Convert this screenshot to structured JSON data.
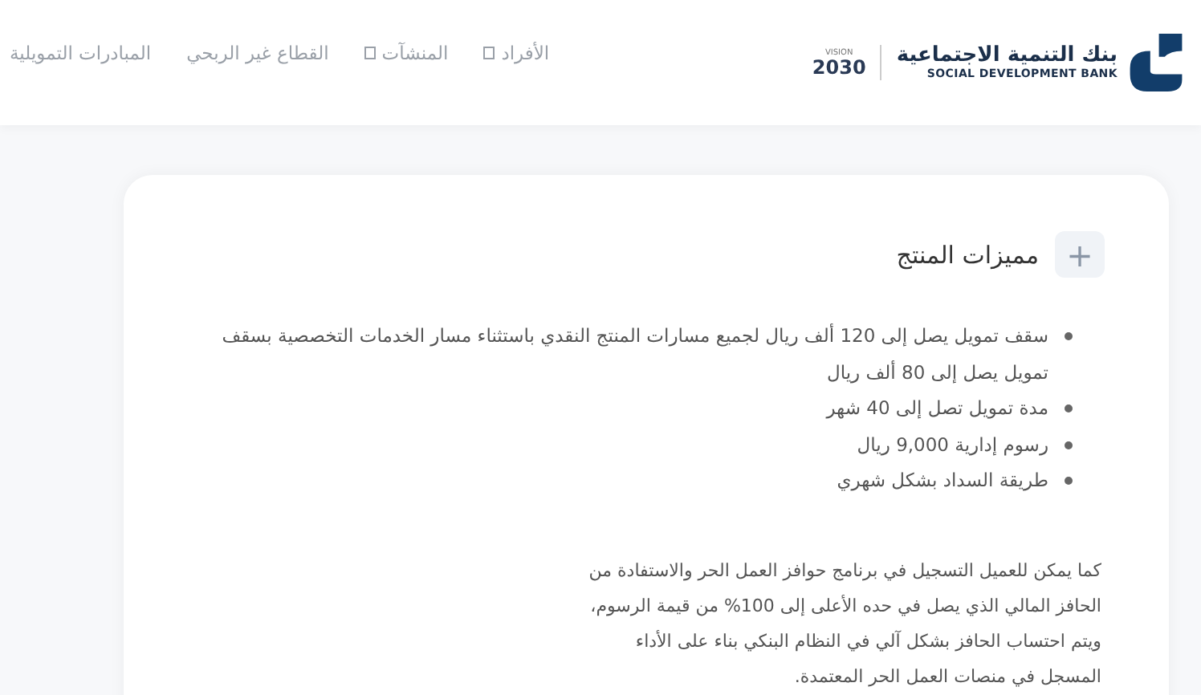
{
  "header": {
    "logo": {
      "name_ar": "بنك التنمية الاجتماعية",
      "name_en": "SOCIAL DEVELOPMENT BANK",
      "vision_label": "VISION",
      "vision_year": "2030"
    },
    "nav": [
      {
        "label": "الأفراد",
        "has_dropdown": true
      },
      {
        "label": "المنشآت",
        "has_dropdown": true
      },
      {
        "label": "القطاع غير الربحي",
        "has_dropdown": false
      },
      {
        "label": "المبادرات التمويلية",
        "has_dropdown": false
      }
    ]
  },
  "section": {
    "title": "مميزات المنتج",
    "expand_symbol": "+",
    "features": [
      "سقف تمويل يصل إلى 120 ألف ريال لجميع مسارات المنتج النقدي باستثناء مسار الخدمات التخصصية بسقف تمويل يصل إلى 80 ألف ريال",
      "مدة تمويل تصل إلى 40 شهر",
      "رسوم إدارية 9,000 ريال",
      "طريقة السداد بشكل شهري"
    ],
    "paragraph": "كما يمكن للعميل التسجيل في برنامج حوافز العمل الحر والاستفادة من الحافز المالي الذي يصل في حده الأعلى إلى 100% من قيمة الرسوم، ويتم احتساب الحافز بشكل آلي في النظام البنكي بناء على الأداء المسجل في منصات العمل الحر المعتمدة."
  }
}
